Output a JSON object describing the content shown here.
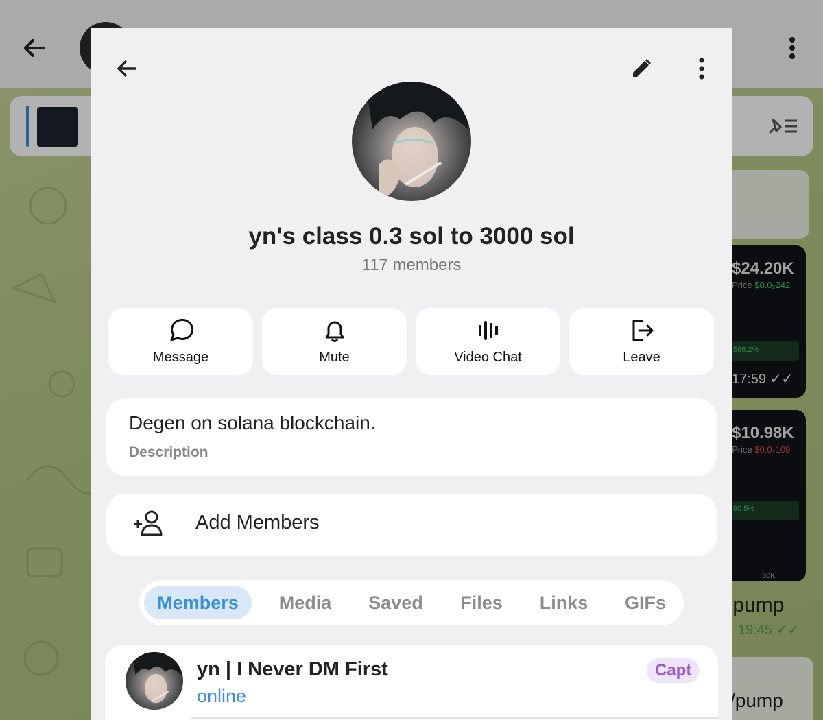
{
  "group": {
    "title": "yn's class 0.3 sol to 3000 sol",
    "members_count": "117 members"
  },
  "actions": [
    {
      "label": "Message",
      "icon": "message-icon"
    },
    {
      "label": "Mute",
      "icon": "bell-icon"
    },
    {
      "label": "Video Chat",
      "icon": "video-chat-icon"
    },
    {
      "label": "Leave",
      "icon": "leave-icon"
    }
  ],
  "description": {
    "text": "Degen on solana blockchain.",
    "label": "Description"
  },
  "add_members": {
    "label": "Add Members",
    "icon": "add-member-icon"
  },
  "tabs": [
    "Members",
    "Media",
    "Saved",
    "Files",
    "Links",
    "GIFs"
  ],
  "active_tab": "Members",
  "members": [
    {
      "name": "yn | I Never DM First",
      "status": "online",
      "badge": "Capt"
    }
  ],
  "background_chat": {
    "card1": {
      "market_cap": "$24.20K",
      "price_label": "Price",
      "price": "$0.0₂242",
      "change": "586.2%",
      "time": "17:59"
    },
    "card2": {
      "market_cap": "$10.98K",
      "price_label": "Price",
      "price": "$0.0₂109",
      "change": "90.5%",
      "axis": "30K"
    },
    "pump1": {
      "text": "/pump",
      "time": "19:45"
    },
    "pump2": {
      "text": "/pump"
    }
  },
  "colors": {
    "accent": "#3a8fd8",
    "panel_bg": "#f0f0f3",
    "badge_text": "#9b57d6",
    "badge_bg": "#efe5fb",
    "tab_active_bg": "#d8e8f6"
  }
}
